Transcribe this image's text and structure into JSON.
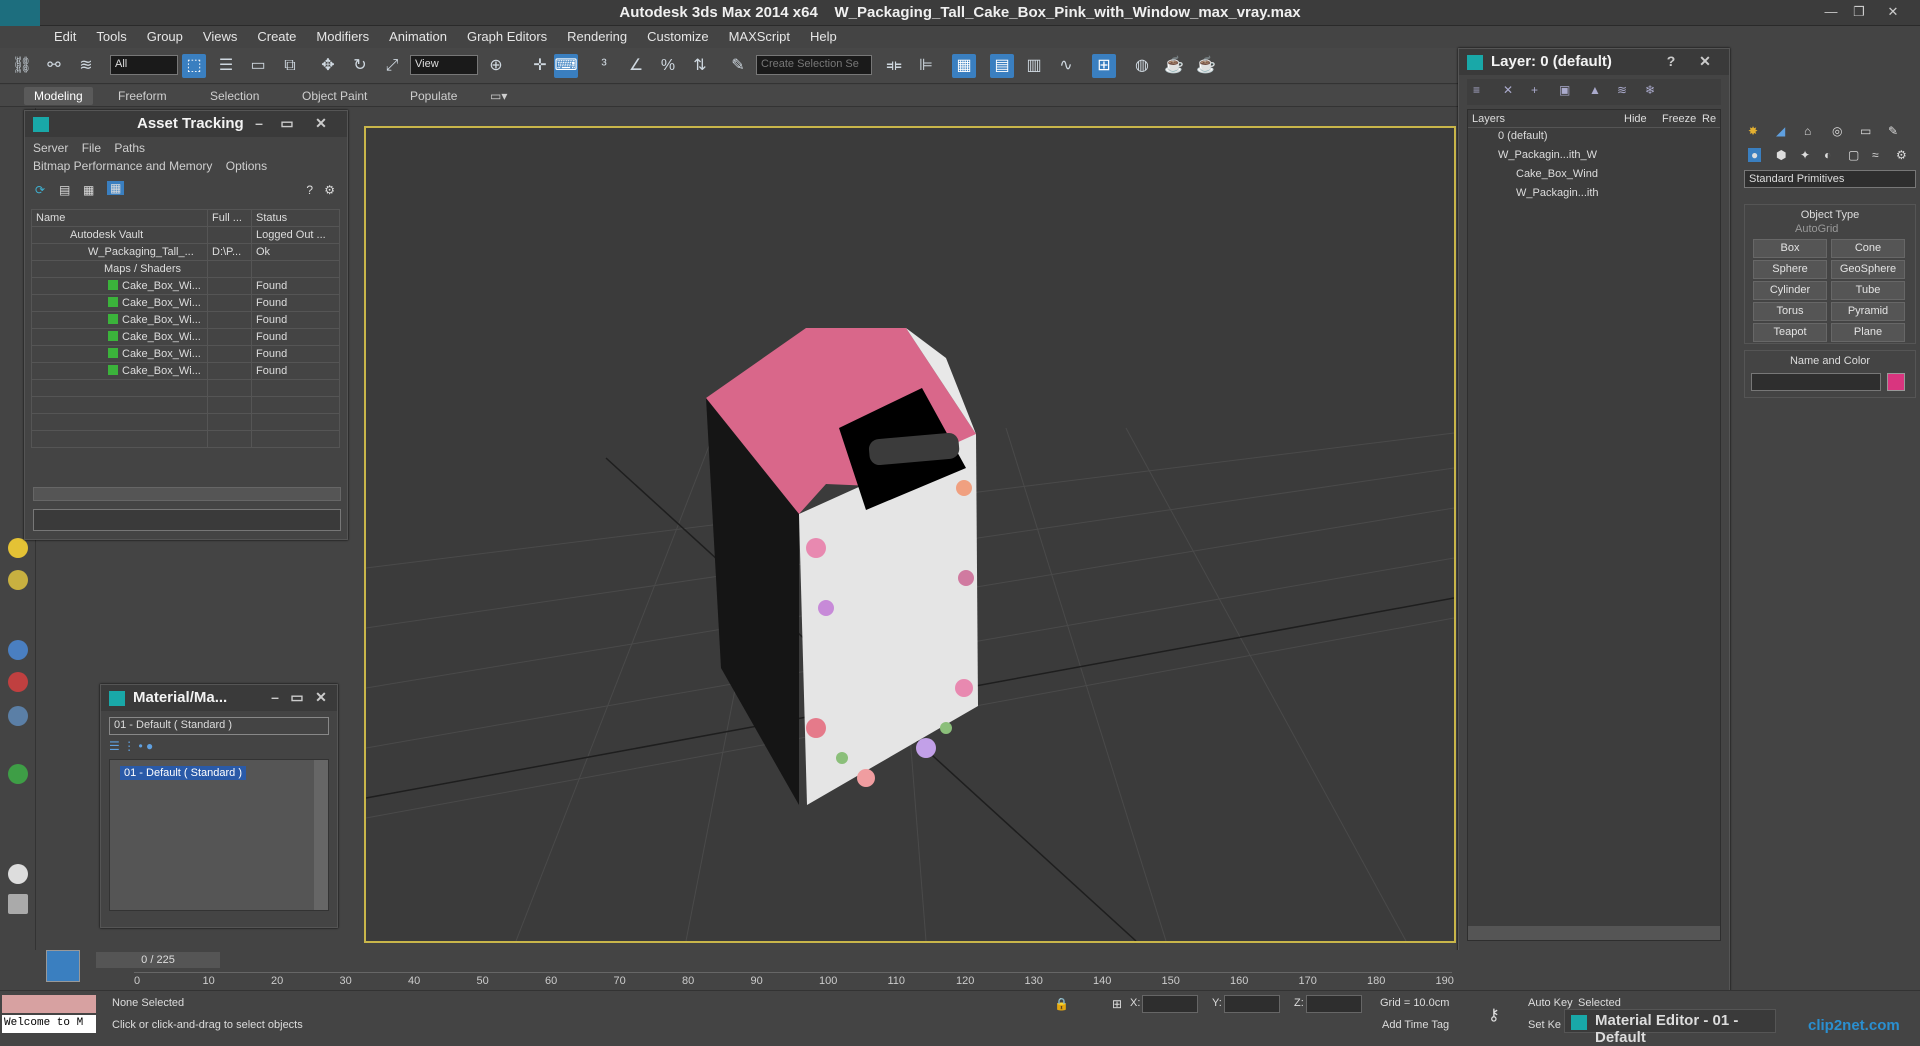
{
  "titlebar": {
    "app_title": "Autodesk 3ds Max  2014 x64",
    "file_title": "W_Packaging_Tall_Cake_Box_Pink_with_Window_max_vray.max"
  },
  "menu": [
    "Edit",
    "Tools",
    "Group",
    "Views",
    "Create",
    "Modifiers",
    "Animation",
    "Graph Editors",
    "Rendering",
    "Customize",
    "MAXScript",
    "Help"
  ],
  "toolbar": {
    "selection_filter": "All",
    "ref_coord": "View",
    "selection_set_placeholder": "Create Selection Se"
  },
  "ribbon": {
    "tabs": [
      "Modeling",
      "Freeform",
      "Selection",
      "Object Paint",
      "Populate"
    ]
  },
  "asset_tracking": {
    "title": "Asset Tracking",
    "menu": [
      "Server",
      "File",
      "Paths"
    ],
    "menu2": [
      "Bitmap Performance and Memory",
      "Options"
    ],
    "columns": [
      "Name",
      "Full ...",
      "Status"
    ],
    "rows": [
      {
        "name": "Autodesk Vault",
        "full": "",
        "status": "Logged Out ..."
      },
      {
        "name": "W_Packaging_Tall_...",
        "full": "D:\\P...",
        "status": "Ok"
      },
      {
        "name": "Maps / Shaders",
        "full": "",
        "status": ""
      },
      {
        "name": "Cake_Box_Wi...",
        "full": "",
        "status": "Found"
      },
      {
        "name": "Cake_Box_Wi...",
        "full": "",
        "status": "Found"
      },
      {
        "name": "Cake_Box_Wi...",
        "full": "",
        "status": "Found"
      },
      {
        "name": "Cake_Box_Wi...",
        "full": "",
        "status": "Found"
      },
      {
        "name": "Cake_Box_Wi...",
        "full": "",
        "status": "Found"
      },
      {
        "name": "Cake_Box_Wi...",
        "full": "",
        "status": "Found"
      }
    ]
  },
  "material_map": {
    "title": "Material/Ma...",
    "current": "01 - Default  ( Standard )",
    "list_item": "01 - Default  ( Standard )"
  },
  "layer_panel": {
    "title": "Layer: 0 (default)",
    "columns": [
      "Layers",
      "Hide",
      "Freeze",
      "Re"
    ],
    "rows": [
      {
        "name": "0 (default)",
        "level": 0
      },
      {
        "name": "W_Packagin...ith_W",
        "level": 0
      },
      {
        "name": "Cake_Box_Wind",
        "level": 1
      },
      {
        "name": "W_Packagin...ith",
        "level": 1
      }
    ]
  },
  "command_panel": {
    "dropdown": "Standard Primitives",
    "object_type_title": "Object Type",
    "autogrid": "AutoGrid",
    "buttons": [
      "Box",
      "Cone",
      "Sphere",
      "GeoSphere",
      "Cylinder",
      "Tube",
      "Torus",
      "Pyramid",
      "Teapot",
      "Plane"
    ],
    "name_color_title": "Name and Color",
    "color": "#d9357f"
  },
  "timeline": {
    "frame_label": "0 / 225",
    "ticks": [
      "0",
      "10",
      "20",
      "30",
      "40",
      "50",
      "60",
      "70",
      "80",
      "90",
      "100",
      "110",
      "120",
      "130",
      "140",
      "150",
      "160",
      "170",
      "180",
      "190"
    ]
  },
  "status": {
    "maxscript": "Welcome to M",
    "selected": "None Selected",
    "prompt": "Click or click-and-drag to select objects",
    "x_label": "X:",
    "y_label": "Y:",
    "z_label": "Z:",
    "grid": "Grid = 10.0cm",
    "add_time_tag": "Add Time Tag",
    "auto_key": "Auto Key",
    "selected_filter": "Selected",
    "set_key": "Set Ke"
  },
  "material_editor_tab": {
    "title": "Material Editor - 01 - Default"
  },
  "watermark": "clip2net.com",
  "colors": {
    "accent": "#3a7fc0",
    "viewport_border": "#c9b64a",
    "box_pink": "#d9678a"
  }
}
